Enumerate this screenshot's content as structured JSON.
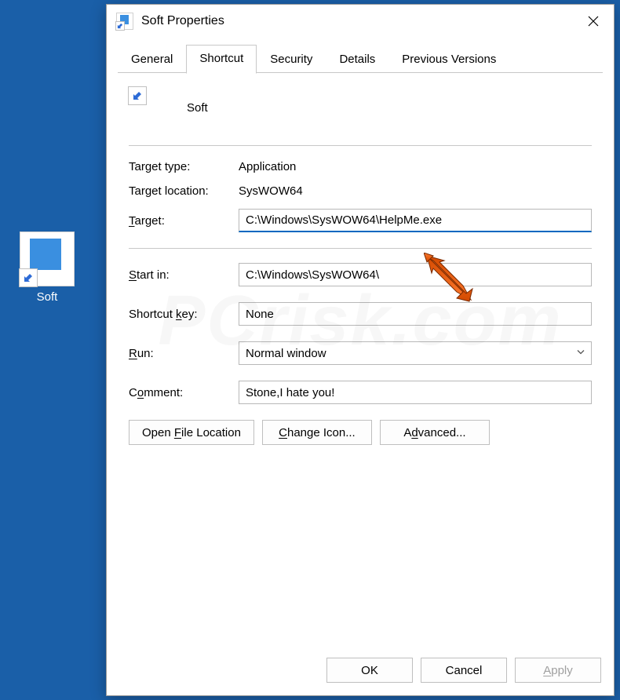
{
  "desktop": {
    "icon_label": "Soft"
  },
  "dialog": {
    "title": "Soft Properties",
    "tabs": {
      "general": "General",
      "shortcut": "Shortcut",
      "security": "Security",
      "details": "Details",
      "previous_versions": "Previous Versions"
    },
    "active_tab": "shortcut",
    "header_name": "Soft",
    "labels": {
      "target_type": "Target type:",
      "target_location": "Target location:",
      "target": "Target:",
      "target_ak": "T",
      "start_in": "Start in:",
      "start_in_ak": "S",
      "shortcut_key": "Shortcut key:",
      "shortcut_key_ak": "k",
      "run": "Run:",
      "run_ak": "R",
      "comment": "Comment:",
      "comment_ak": "o"
    },
    "values": {
      "target_type": "Application",
      "target_location": "SysWOW64",
      "target": "C:\\Windows\\SysWOW64\\HelpMe.exe",
      "start_in": "C:\\Windows\\SysWOW64\\",
      "shortcut_key": "None",
      "run": "Normal window",
      "comment": "Stone,I hate you!"
    },
    "buttons": {
      "open_file_location": "Open File Location",
      "open_file_location_ak": "F",
      "change_icon": "Change Icon...",
      "change_icon_ak": "C",
      "advanced": "Advanced...",
      "advanced_ak": "d",
      "ok": "OK",
      "cancel": "Cancel",
      "apply": "Apply",
      "apply_ak": "A"
    }
  },
  "watermark_text": "PCrisk.com"
}
